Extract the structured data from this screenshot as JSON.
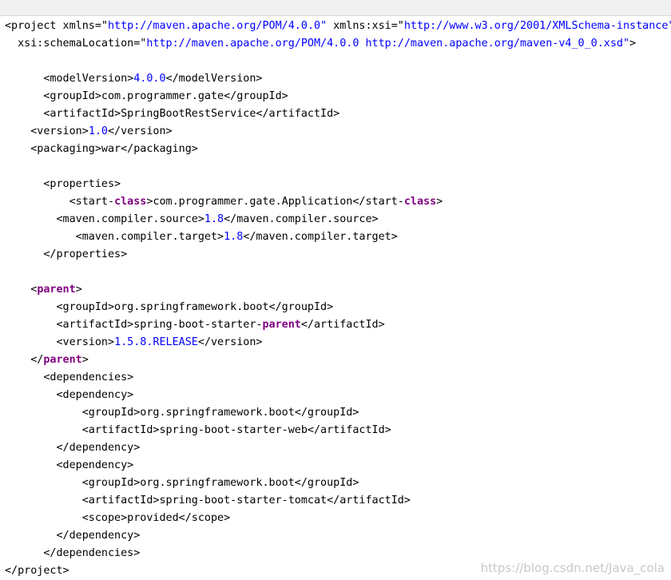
{
  "colors": {
    "text": "#000000",
    "value": "#0000ff",
    "keyword": "#7f007f",
    "watermark": "#c8c8c8"
  },
  "lines": [
    [
      {
        "t": "<project xmlns=\""
      },
      {
        "t": "http://maven.apache.org/POM/4.0.0\"",
        "c": "v"
      },
      {
        "t": " xmlns:xsi=\""
      },
      {
        "t": "http://www.w3.org/2001/XMLSchema-instance\"",
        "c": "v"
      }
    ],
    [
      {
        "t": "  xsi:schemaLocation=\""
      },
      {
        "t": "http://maven.apache.org/POM/4.0.0 http://maven.apache.org/maven-v4_0_0.xsd\"",
        "c": "v"
      },
      {
        "t": ">"
      }
    ],
    [
      {
        "t": ""
      }
    ],
    [
      {
        "t": "      <modelVersion>"
      },
      {
        "t": "4.0.0",
        "c": "v"
      },
      {
        "t": "</modelVersion>"
      }
    ],
    [
      {
        "t": "      <groupId>com.programmer.gate</groupId>"
      }
    ],
    [
      {
        "t": "      <artifactId>SpringBootRestService</artifactId>"
      }
    ],
    [
      {
        "t": "    <version>"
      },
      {
        "t": "1.0",
        "c": "v"
      },
      {
        "t": "</version>"
      }
    ],
    [
      {
        "t": "    <packaging>war</packaging>"
      }
    ],
    [
      {
        "t": ""
      }
    ],
    [
      {
        "t": "      <properties>"
      }
    ],
    [
      {
        "t": "          <start-"
      },
      {
        "t": "class",
        "c": "k"
      },
      {
        "t": ">com.programmer.gate.Application</start-"
      },
      {
        "t": "class",
        "c": "k"
      },
      {
        "t": ">"
      }
    ],
    [
      {
        "t": "        <maven.compiler.source>"
      },
      {
        "t": "1.8",
        "c": "v"
      },
      {
        "t": "</maven.compiler.source>"
      }
    ],
    [
      {
        "t": "           <maven.compiler.target>"
      },
      {
        "t": "1.8",
        "c": "v"
      },
      {
        "t": "</maven.compiler.target>"
      }
    ],
    [
      {
        "t": "      </properties>"
      }
    ],
    [
      {
        "t": ""
      }
    ],
    [
      {
        "t": "    <"
      },
      {
        "t": "parent",
        "c": "k"
      },
      {
        "t": ">"
      }
    ],
    [
      {
        "t": "        <groupId>org.springframework.boot</groupId>"
      }
    ],
    [
      {
        "t": "        <artifactId>spring-boot-starter-"
      },
      {
        "t": "parent",
        "c": "k"
      },
      {
        "t": "</artifactId>"
      }
    ],
    [
      {
        "t": "        <version>"
      },
      {
        "t": "1.5.8.RELEASE",
        "c": "v"
      },
      {
        "t": "</version>"
      }
    ],
    [
      {
        "t": "    </"
      },
      {
        "t": "parent",
        "c": "k"
      },
      {
        "t": ">"
      }
    ],
    [
      {
        "t": "      <dependencies>"
      }
    ],
    [
      {
        "t": "        <dependency>"
      }
    ],
    [
      {
        "t": "            <groupId>org.springframework.boot</groupId>"
      }
    ],
    [
      {
        "t": "            <artifactId>spring-boot-starter-web</artifactId>"
      }
    ],
    [
      {
        "t": "        </dependency>"
      }
    ],
    [
      {
        "t": "        <dependency>"
      }
    ],
    [
      {
        "t": "            <groupId>org.springframework.boot</groupId>"
      }
    ],
    [
      {
        "t": "            <artifactId>spring-boot-starter-tomcat</artifactId>"
      }
    ],
    [
      {
        "t": "            <scope>provided</scope>"
      }
    ],
    [
      {
        "t": "        </dependency>"
      }
    ],
    [
      {
        "t": "      </dependencies>"
      }
    ],
    [
      {
        "t": "</project>"
      }
    ]
  ],
  "watermark": "https://blog.csdn.net/Java_cola"
}
